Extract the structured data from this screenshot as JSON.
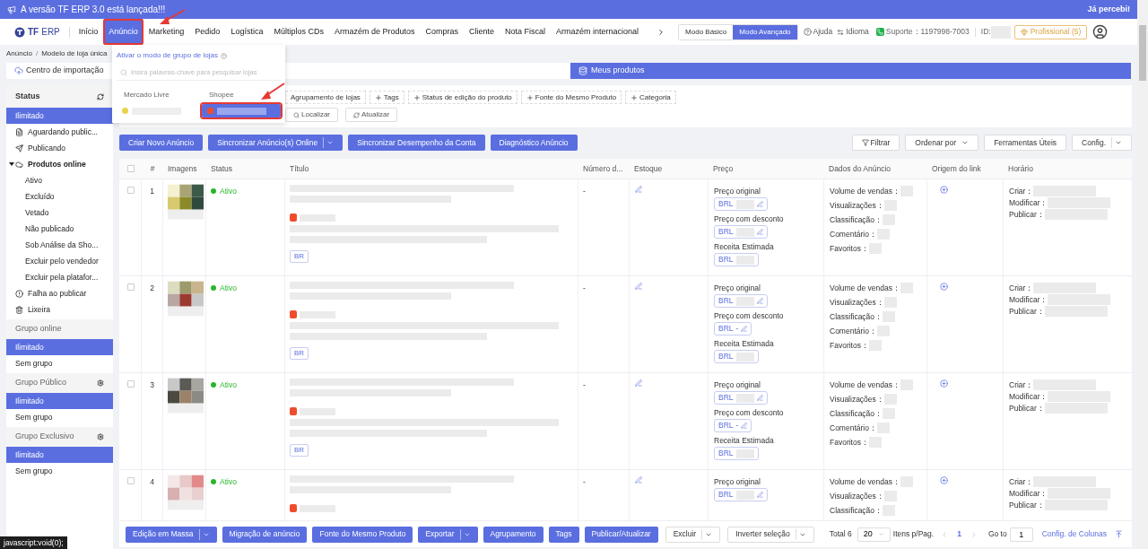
{
  "banner": {
    "message": "A versão TF ERP 3.0 está lançada!!!",
    "dismiss": "Já percebi!"
  },
  "logo": {
    "brand": "TF",
    "product": "ERP"
  },
  "nav": [
    {
      "label": "Início",
      "selected": false,
      "highlighted": false
    },
    {
      "label": "Anúncio",
      "selected": true,
      "highlighted": true
    },
    {
      "label": "Marketing",
      "selected": false,
      "highlighted": false
    },
    {
      "label": "Pedido",
      "selected": false,
      "highlighted": false
    },
    {
      "label": "Logística",
      "selected": false,
      "highlighted": false
    },
    {
      "label": "Múltiplos CDs",
      "selected": false,
      "highlighted": false
    },
    {
      "label": "Armazém de Produtos",
      "selected": false,
      "highlighted": false
    },
    {
      "label": "Compras",
      "selected": false,
      "highlighted": false
    },
    {
      "label": "Cliente",
      "selected": false,
      "highlighted": false
    },
    {
      "label": "Nota Fiscal",
      "selected": false,
      "highlighted": false
    },
    {
      "label": "Armazém internacional",
      "selected": false,
      "highlighted": false
    }
  ],
  "modes": [
    {
      "label": "Modo Básico",
      "selected": false
    },
    {
      "label": "Modo Avançado",
      "selected": true
    }
  ],
  "header_links": {
    "help": "Ajuda",
    "language": "Idioma",
    "support": "Suporte：1197998-7003",
    "id_label": "ID:",
    "plan": "Profissional (5)"
  },
  "breadcrumb": [
    "Anúncio",
    "Modelo de loja única"
  ],
  "breadcrumb_separator": "/",
  "import_center": "Centro de importação",
  "page_title": "Meus produtos",
  "store_dropdown": {
    "group_mode_link": "Ativar o modo de grupo de lojas",
    "search_placeholder": "Insira palavras-chave para pesquisar lojas",
    "platforms": [
      {
        "name": "Mercado Livre",
        "stores": [
          {
            "selected": false,
            "highlighted": false
          }
        ]
      },
      {
        "name": "Shopee",
        "stores": [
          {
            "selected": true,
            "highlighted": true
          }
        ]
      }
    ]
  },
  "sidebar": [
    {
      "title": "Status",
      "items": [
        {
          "label": "Ilimitado",
          "kind": "plain",
          "selected": true
        },
        {
          "label": "Aguardando public...",
          "kind": "draft",
          "selected": false
        },
        {
          "label": "Publicando",
          "kind": "send",
          "selected": false
        },
        {
          "label": "Produtos online",
          "kind": "cloud",
          "selected": false,
          "expanded": true,
          "children": [
            {
              "label": "Ativo",
              "selected": false
            },
            {
              "label": "Excluído",
              "selected": false
            },
            {
              "label": "Vetado",
              "selected": false
            },
            {
              "label": "Não publicado",
              "selected": false
            },
            {
              "label": "Sob Análise da Sho...",
              "selected": false
            },
            {
              "label": "Excluir pelo vendedor",
              "selected": false
            },
            {
              "label": "Excluir pela platafor...",
              "selected": false
            }
          ]
        },
        {
          "label": "Falha ao publicar",
          "kind": "alert",
          "selected": false
        },
        {
          "label": "Lixeira",
          "kind": "trash",
          "selected": false
        }
      ]
    },
    {
      "title": "Grupo online",
      "items": [
        {
          "label": "Ilimitado",
          "kind": "plain",
          "selected": true
        },
        {
          "label": "Sem grupo",
          "kind": "plain",
          "selected": false
        }
      ]
    },
    {
      "title": "Grupo Público",
      "items": [
        {
          "label": "Ilimitado",
          "kind": "plain",
          "selected": true
        },
        {
          "label": "Sem grupo",
          "kind": "plain",
          "selected": false
        }
      ]
    },
    {
      "title": "Grupo Exclusivo",
      "items": [
        {
          "label": "Ilimitado",
          "kind": "plain",
          "selected": true
        },
        {
          "label": "Sem grupo",
          "kind": "plain",
          "selected": false
        }
      ]
    }
  ],
  "filters": {
    "chips": [
      {
        "label": "Agrupamento de lojas",
        "plus": false
      },
      {
        "label": "Tags",
        "plus": true
      },
      {
        "label": "Status de edição do produto",
        "plus": true
      },
      {
        "label": "Fonte do Mesmo Produto",
        "plus": true
      },
      {
        "label": "Categoria",
        "plus": true
      }
    ],
    "search_button": "Localizar",
    "refresh_button": "Atualizar"
  },
  "actions": [
    {
      "label": "Criar Novo Anúncio",
      "split": false
    },
    {
      "label": "Sincronizar Anúncio(s) Online",
      "split": true
    },
    {
      "label": "Sincronizar Desempenho da Conta",
      "split": false
    },
    {
      "label": "Diagnóstico Anúncio",
      "split": false
    }
  ],
  "tools": [
    {
      "label": "Filtrar",
      "kind": "filter",
      "split": false
    },
    {
      "label": "Ordenar por",
      "kind": "dropdown",
      "split": false
    },
    {
      "label": "Ferramentas Úteis",
      "kind": "plain",
      "split": false
    },
    {
      "label": "Config.",
      "kind": "plain",
      "split": true
    }
  ],
  "table": {
    "select_all_checked": false,
    "columns": [
      "#",
      "Imagens",
      "Status",
      "Título",
      "Número d...",
      "Estoque",
      "Preço",
      "Dados do Anúncio",
      "Origem do link",
      "Horário"
    ],
    "rows": [
      {
        "index": "1",
        "checked": false,
        "status": "Ativo",
        "region_tag": "BR",
        "number": "-",
        "prices": [
          {
            "label": "Preço original",
            "currency": "BRL",
            "editable": true
          },
          {
            "label": "Preço com desconto",
            "currency": "BRL",
            "editable": true
          },
          {
            "label": "Receita Estimada",
            "currency": "BRL",
            "editable": false
          }
        ],
        "stats": [
          "Volume de vendas：",
          "Visualizações：",
          "Classificação：",
          "Comentário：",
          "Favoritos："
        ],
        "times": [
          "Criar：",
          "Modificar：",
          "Publicar："
        ]
      },
      {
        "index": "2",
        "checked": false,
        "status": "Ativo",
        "region_tag": "BR",
        "number": "-",
        "prices": [
          {
            "label": "Preço original",
            "currency": "BRL",
            "editable": true
          },
          {
            "label": "Preço com desconto",
            "currency": "BRL",
            "value": "-",
            "editable": true
          },
          {
            "label": "Receita Estimada",
            "currency": "BRL",
            "editable": false
          }
        ],
        "stats": [
          "Volume de vendas：",
          "Visualizações：",
          "Classificação：",
          "Comentário：",
          "Favoritos："
        ],
        "times": [
          "Criar：",
          "Modificar：",
          "Publicar："
        ]
      },
      {
        "index": "3",
        "checked": false,
        "status": "Ativo",
        "region_tag": "BR",
        "number": "-",
        "prices": [
          {
            "label": "Preço original",
            "currency": "BRL",
            "editable": true
          },
          {
            "label": "Preço com desconto",
            "currency": "BRL",
            "value": "-",
            "editable": true
          },
          {
            "label": "Receita Estimada",
            "currency": "BRL",
            "editable": false
          }
        ],
        "stats": [
          "Volume de vendas：",
          "Visualizações：",
          "Classificação：",
          "Comentário：",
          "Favoritos："
        ],
        "times": [
          "Criar：",
          "Modificar：",
          "Publicar："
        ]
      },
      {
        "index": "4",
        "checked": false,
        "status": "Ativo",
        "number": "-",
        "prices": [
          {
            "label": "Preço original",
            "currency": "BRL",
            "editable": true
          }
        ],
        "stats": [
          "Volume de vendas：",
          "Visualizações：",
          "Classificação："
        ],
        "times": [
          "Criar：",
          "Modificar：",
          "Publicar："
        ]
      }
    ]
  },
  "bulk_actions": [
    {
      "label": "Edição em Massa",
      "split": true
    },
    {
      "label": "Migração de anúncio",
      "split": false
    },
    {
      "label": "Fonte do Mesmo Produto",
      "split": false
    },
    {
      "label": "Exportar",
      "split": true
    },
    {
      "label": "Agrupamento",
      "split": false
    },
    {
      "label": "Tags",
      "split": false
    },
    {
      "label": "Publicar/Atualizar",
      "split": false
    }
  ],
  "secondary_actions": [
    {
      "label": "Excluir"
    },
    {
      "label": "Inverter seleção"
    }
  ],
  "pagination": {
    "total": "Total 6",
    "page_size": "20",
    "per_page_label": "Itens p/Pag.",
    "pages": [
      {
        "label": "1",
        "selected": true
      }
    ],
    "goto_label": "Go to",
    "goto_value": "1"
  },
  "column_config": "Config. de Colunas",
  "status_bar": "javascript:void(0);"
}
